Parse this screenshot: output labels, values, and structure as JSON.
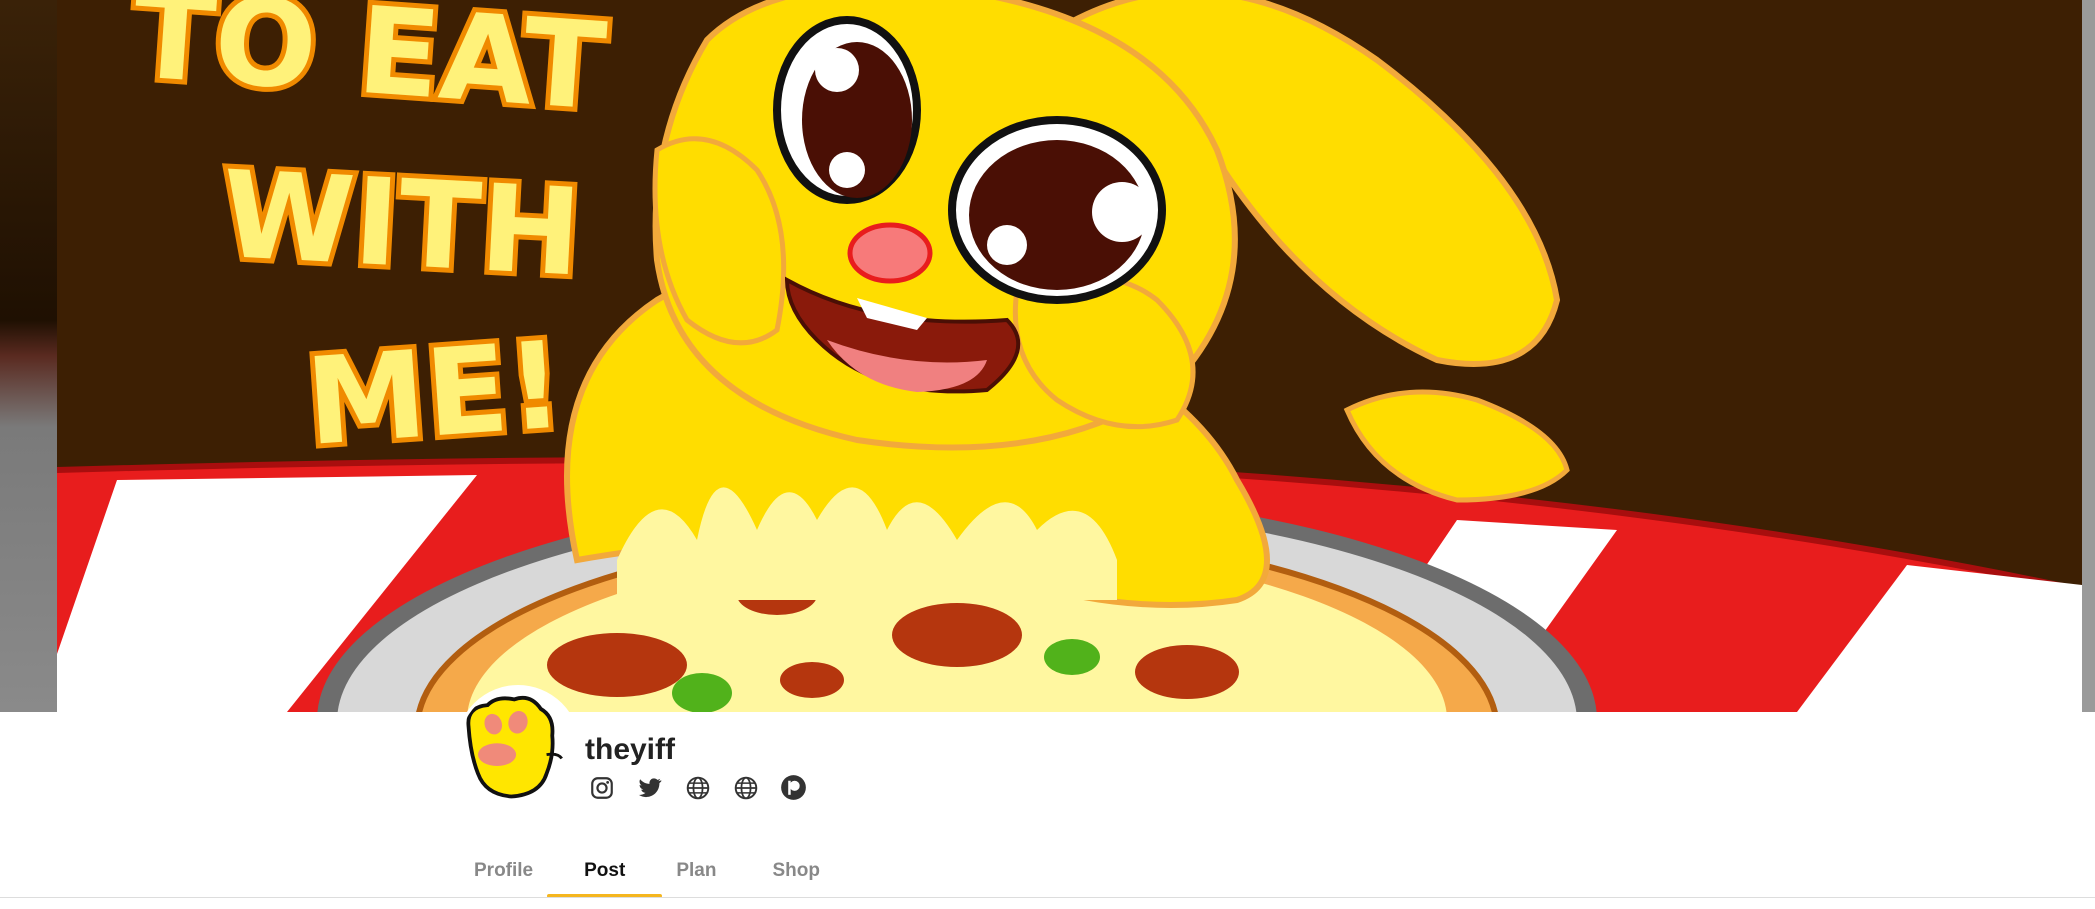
{
  "banner": {
    "headline_lines": [
      "TO EAT",
      "WITH",
      "ME!"
    ],
    "colors": {
      "background": "#3d1f03",
      "character": "#ffdd00",
      "text_fill": "#fff27a",
      "text_outline": "#f08a00",
      "tablecloth_red": "#e81d1d"
    }
  },
  "creator": {
    "name": "theyiff",
    "avatar_icon": "yellow-paw-icon"
  },
  "links": [
    {
      "icon": "instagram-icon"
    },
    {
      "icon": "twitter-icon"
    },
    {
      "icon": "globe-icon"
    },
    {
      "icon": "globe-icon"
    },
    {
      "icon": "patreon-icon"
    }
  ],
  "tabs": [
    {
      "label": "Profile",
      "active": false
    },
    {
      "label": "Post",
      "active": true
    },
    {
      "label": "Plan",
      "active": false
    },
    {
      "label": "Shop",
      "active": false
    }
  ],
  "accent_color": "#f5b61f"
}
